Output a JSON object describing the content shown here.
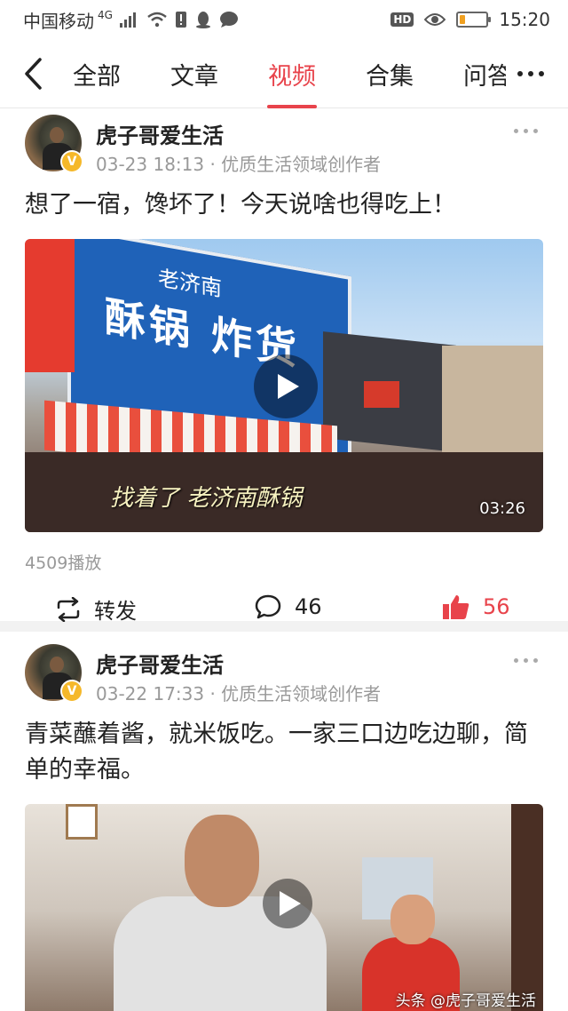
{
  "status_bar": {
    "carrier": "中国移动",
    "network": "4G",
    "time": "15:20",
    "hd_badge": "HD",
    "battery_level": 0.2
  },
  "tabs": {
    "items": [
      {
        "label": "全部"
      },
      {
        "label": "文章"
      },
      {
        "label": "视频"
      },
      {
        "label": "合集"
      },
      {
        "label": "问答"
      }
    ],
    "active_index": 2
  },
  "posts": [
    {
      "author": "虎子哥爱生活",
      "meta": "03-23 18:13 · 优质生活领域创作者",
      "text": "想了一宿，馋坏了！今天说啥也得吃上！",
      "video": {
        "duration": "03:26",
        "subtitle": "找着了  老济南酥锅",
        "sign_text": "酥锅 炸货",
        "sign_subtext": "老济南"
      },
      "play_count": "4509播放",
      "actions": {
        "share_label": "转发",
        "comment_count": "46",
        "like_count": "56"
      }
    },
    {
      "author": "虎子哥爱生活",
      "meta": "03-22 17:33 · 优质生活领域创作者",
      "text": "青菜蘸着酱，就米饭吃。一家三口边吃边聊，简单的幸福。",
      "video": {
        "watermark": "头条 @虎子哥爱生活"
      }
    }
  ],
  "colors": {
    "accent": "#e8434b",
    "verify_badge": "#f5b82a",
    "meta_text": "#999999"
  },
  "icons": [
    "back-arrow-icon",
    "more-dots-icon",
    "share-repost-icon",
    "comment-bubble-icon",
    "thumbs-up-icon",
    "play-icon",
    "verified-icon"
  ]
}
